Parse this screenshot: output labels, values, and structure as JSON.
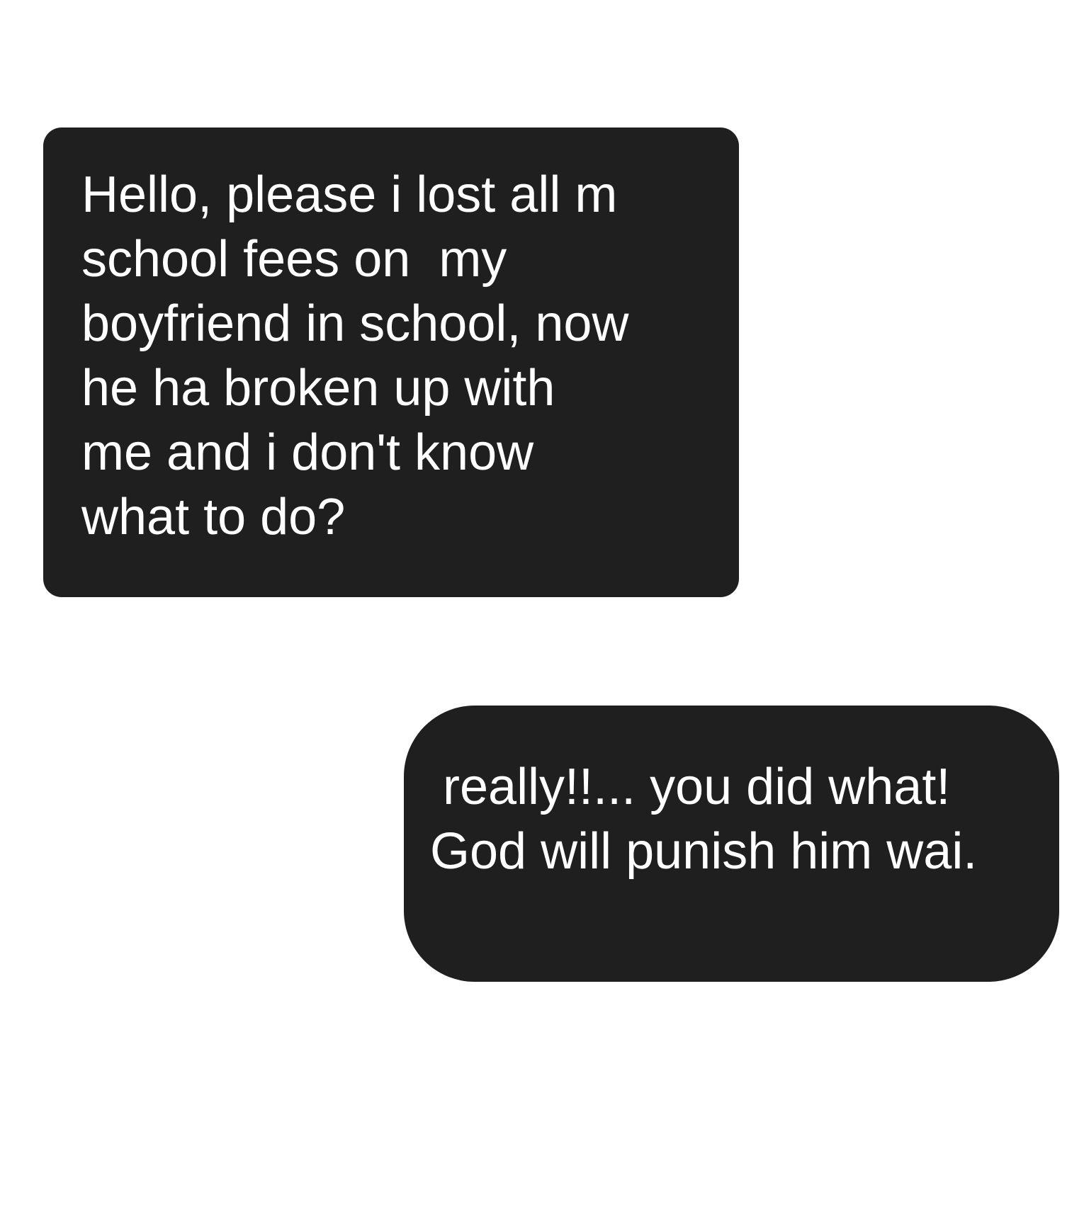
{
  "messages": [
    {
      "direction": "incoming",
      "lines": [
        "Hello, please i lost all m",
        "school fees on  my",
        "boyfriend in school, now",
        "he ha broken up with",
        "me and i don't know",
        "what to do?"
      ]
    },
    {
      "direction": "outgoing",
      "lines": [
        "really!!... you did what!",
        "God will punish him wai."
      ]
    }
  ],
  "colors": {
    "background": "#ffffff",
    "bubble": "#1f1f1f",
    "text": "#ffffff"
  }
}
